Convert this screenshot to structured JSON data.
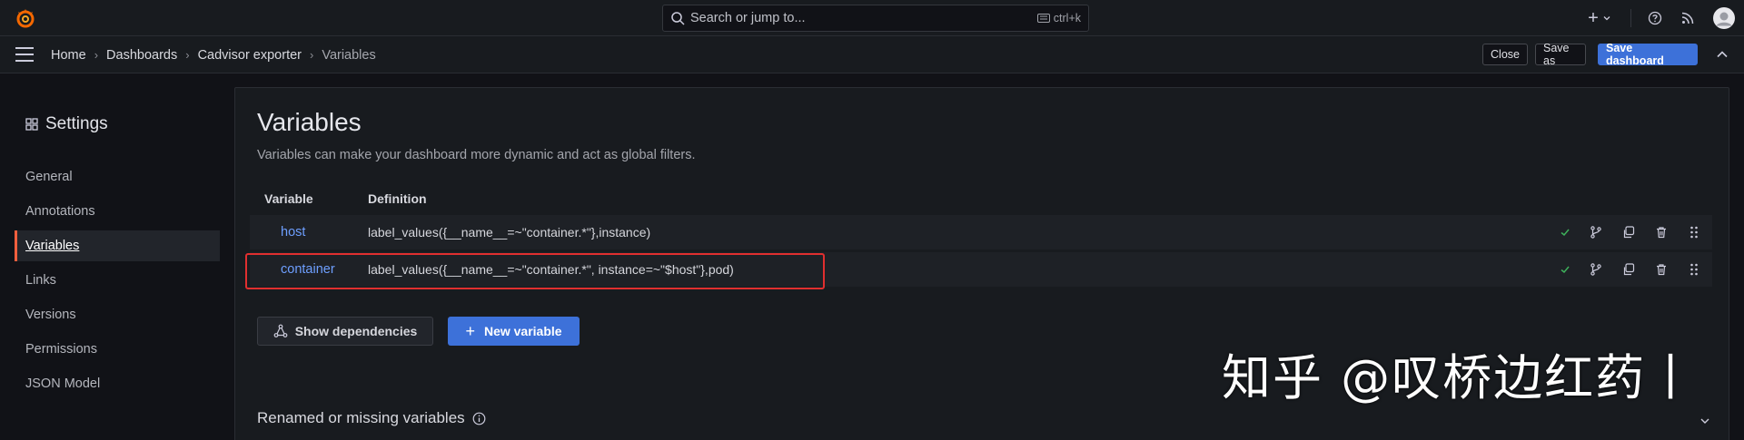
{
  "topbar": {
    "search_placeholder": "Search or jump to...",
    "search_shortcut": "ctrl+k",
    "add_label": "+",
    "colors": {
      "logo": "#f46800",
      "accent": "#3d71d9"
    }
  },
  "breadcrumb": [
    "Home",
    "Dashboards",
    "Cadvisor exporter",
    "Variables"
  ],
  "actions": {
    "close": "Close",
    "save_as": "Save as",
    "save_dashboard": "Save dashboard"
  },
  "sidebar": {
    "title": "Settings",
    "items": [
      {
        "label": "General"
      },
      {
        "label": "Annotations"
      },
      {
        "label": "Variables",
        "active": true
      },
      {
        "label": "Links"
      },
      {
        "label": "Versions"
      },
      {
        "label": "Permissions"
      },
      {
        "label": "JSON Model"
      }
    ]
  },
  "main": {
    "title": "Variables",
    "description": "Variables can make your dashboard more dynamic and act as global filters.",
    "columns": [
      "Variable",
      "Definition"
    ],
    "rows": [
      {
        "name": "host",
        "definition": "label_values({__name__=~\"container.*\"},instance)"
      },
      {
        "name": "container",
        "definition": "label_values({__name__=~\"container.*\", instance=~\"$host\"},pod)"
      }
    ],
    "show_dependencies": "Show dependencies",
    "new_variable": "New variable",
    "renamed_section": "Renamed or missing variables"
  },
  "watermark": "知乎 @叹桥边红药丨"
}
